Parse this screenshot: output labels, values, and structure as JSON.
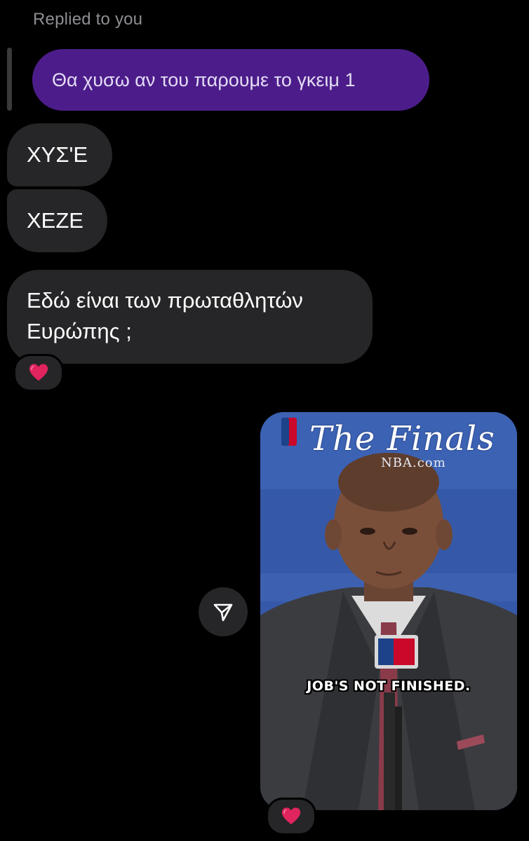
{
  "reply_header": {
    "label": "Replied to you"
  },
  "quoted_message": {
    "text": "Θα χυσω αν του παρουμε το γκειμ 1"
  },
  "messages": [
    {
      "text": "ΧΥΣ'Ε"
    },
    {
      "text": "ΧΕΖΕ"
    },
    {
      "text_line1": "Εδώ είναι των πρωταθλητών",
      "text_line2": "Ευρώπης ;"
    }
  ],
  "reactions": {
    "message_reaction": "heart",
    "media_reaction": "heart"
  },
  "media": {
    "logo_text": "The Finals",
    "logo_subtext": "NBA.com",
    "caption": "JOB'S NOT FINISHED."
  },
  "icons": {
    "share": "paper-plane-icon",
    "reaction": "red-heart-icon"
  },
  "colors": {
    "background": "#000000",
    "quoted_bubble": "#4c1d8a",
    "received_bubble": "#262628",
    "heart": "#e0245e"
  }
}
